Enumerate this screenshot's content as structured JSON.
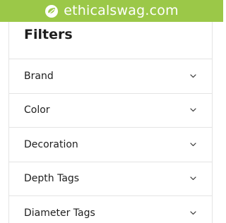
{
  "brand": {
    "name": "ethicalswag.com",
    "logo_icon": "leaf-circle-icon",
    "bar_color": "#9bc848"
  },
  "filters": {
    "title": "Filters",
    "items": [
      {
        "label": "Brand",
        "icon": "chevron-down-icon"
      },
      {
        "label": "Color",
        "icon": "chevron-down-icon"
      },
      {
        "label": "Decoration",
        "icon": "chevron-down-icon"
      },
      {
        "label": "Depth Tags",
        "icon": "chevron-down-icon"
      },
      {
        "label": "Diameter Tags",
        "icon": "chevron-down-icon"
      }
    ]
  }
}
